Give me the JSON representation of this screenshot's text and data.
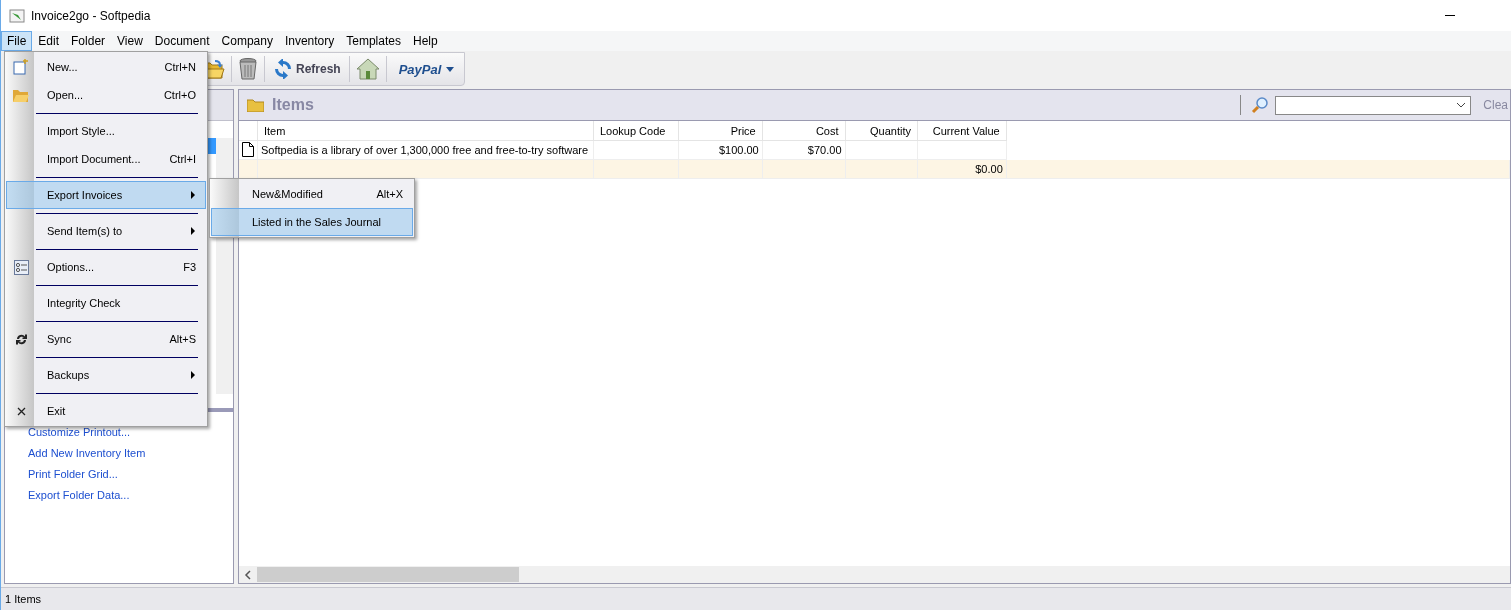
{
  "window": {
    "title": "Invoice2go - Softpedia"
  },
  "menu_bar": [
    {
      "label": "File",
      "selected": true
    },
    {
      "label": "Edit",
      "selected": false
    },
    {
      "label": "Folder",
      "selected": false
    },
    {
      "label": "View",
      "selected": false
    },
    {
      "label": "Document",
      "selected": false
    },
    {
      "label": "Company",
      "selected": false
    },
    {
      "label": "Inventory",
      "selected": false
    },
    {
      "label": "Templates",
      "selected": false
    },
    {
      "label": "Help",
      "selected": false
    }
  ],
  "toolbar": [
    {
      "kind": "open"
    },
    {
      "kind": "delete"
    },
    {
      "kind": "refresh",
      "label": "Refresh"
    },
    {
      "kind": "home"
    },
    {
      "kind": "dropdown",
      "label": "PayPal"
    }
  ],
  "left_panel": {
    "tasks": [
      "Customize Printout...",
      "Add New Inventory Item",
      "Print Folder Grid...",
      "Export Folder Data..."
    ]
  },
  "items_panel": {
    "title": "Items",
    "clear_label": "Clea",
    "table": {
      "columns": [
        "Item",
        "Lookup Code",
        "Price",
        "Cost",
        "Quantity",
        "Current Value"
      ],
      "rows": [
        {
          "cells": [
            "Softpedia is a library of over 1,300,000 free and free-to-try software",
            "",
            "$100.00",
            "$70.00",
            "",
            ""
          ]
        }
      ],
      "total_row": {
        "current_value": "$0.00"
      }
    }
  },
  "file_menu": [
    {
      "kind": "item",
      "label": "New...",
      "shortcut": "Ctrl+N",
      "selected": false
    },
    {
      "kind": "item",
      "label": "Open...",
      "shortcut": "Ctrl+O",
      "selected": false
    },
    {
      "kind": "separator"
    },
    {
      "kind": "item",
      "label": "Import Style...",
      "selected": false
    },
    {
      "kind": "item",
      "label": "Import Document...",
      "shortcut": "Ctrl+I",
      "selected": false
    },
    {
      "kind": "separator"
    },
    {
      "kind": "submenu",
      "label": "Export Invoices",
      "selected": true
    },
    {
      "kind": "separator"
    },
    {
      "kind": "submenu",
      "label": "Send Item(s) to",
      "selected": false
    },
    {
      "kind": "separator"
    },
    {
      "kind": "item",
      "label": "Options...",
      "shortcut": "F3",
      "selected": false
    },
    {
      "kind": "separator"
    },
    {
      "kind": "item",
      "label": "Integrity Check",
      "selected": false
    },
    {
      "kind": "separator"
    },
    {
      "kind": "item",
      "label": "Sync",
      "shortcut": "Alt+S",
      "selected": false
    },
    {
      "kind": "separator"
    },
    {
      "kind": "submenu",
      "label": "Backups",
      "selected": false
    },
    {
      "kind": "separator"
    },
    {
      "kind": "item",
      "label": "Exit",
      "selected": false
    }
  ],
  "export_submenu": [
    {
      "label": "New&Modified",
      "shortcut": "Alt+X",
      "selected": false
    },
    {
      "label": "Listed in the Sales Journal",
      "selected": true
    }
  ],
  "status_bar": "1 Items"
}
